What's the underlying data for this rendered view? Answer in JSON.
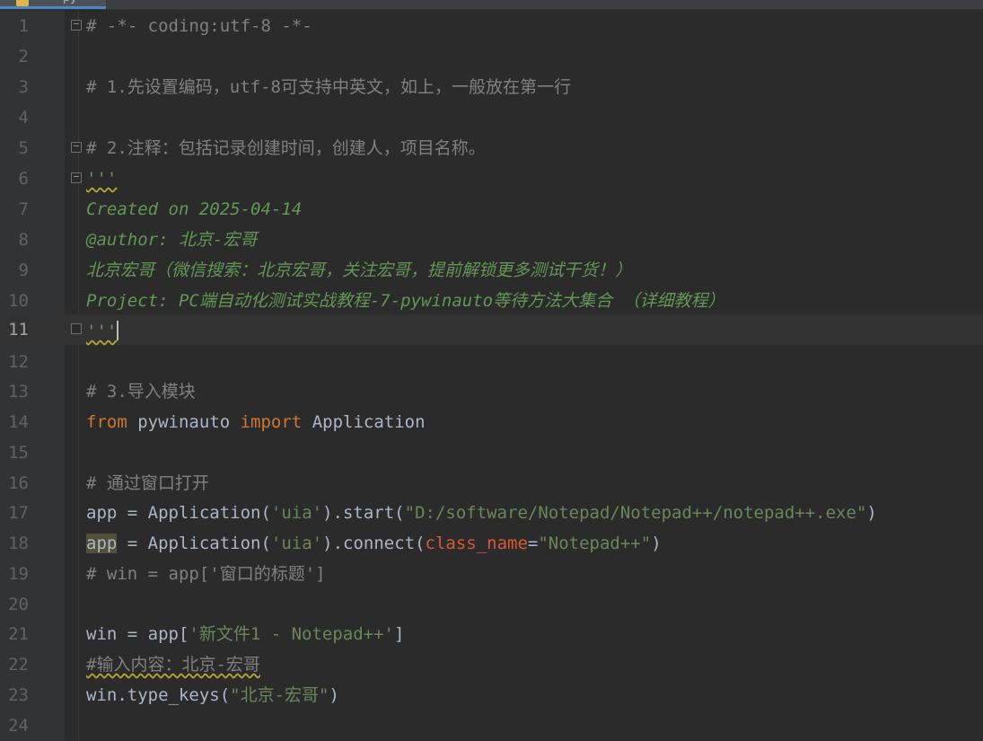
{
  "tab": {
    "label": "py"
  },
  "editor": {
    "current_line": 11,
    "lines": [
      {
        "num": "1",
        "text": "# -*- coding:utf-8 -*-"
      },
      {
        "num": "2",
        "text": ""
      },
      {
        "num": "3",
        "text": "# 1.先设置编码，utf-8可支持中英文，如上，一般放在第一行"
      },
      {
        "num": "4",
        "text": ""
      },
      {
        "num": "5",
        "text": "# 2.注释：包括记录创建时间，创建人，项目名称。"
      },
      {
        "num": "6",
        "text": "'''"
      },
      {
        "num": "7",
        "text": "Created on 2025-04-14"
      },
      {
        "num": "8",
        "text": "@author: 北京-宏哥"
      },
      {
        "num": "9",
        "text": "北京宏哥（微信搜索：北京宏哥，关注宏哥，提前解锁更多测试干货！）"
      },
      {
        "num": "10",
        "text": "Project: PC端自动化测试实战教程-7-pywinauto等待方法大集合 （详细教程）"
      },
      {
        "num": "11",
        "text": "'''"
      },
      {
        "num": "12",
        "text": ""
      },
      {
        "num": "13",
        "text": "# 3.导入模块"
      },
      {
        "num": "14",
        "kw1": "from",
        "mod": " pywinauto ",
        "kw2": "import",
        "rest": " Application"
      },
      {
        "num": "15",
        "text": ""
      },
      {
        "num": "16",
        "text": "# 通过窗口打开"
      },
      {
        "num": "17",
        "a": "app = Application(",
        "s1": "'uia'",
        "b": ").start(",
        "s2": "\"D:/software/Notepad/Notepad++/notepad++.exe\"",
        "c": ")"
      },
      {
        "num": "18",
        "var": "app",
        "a": " = Application(",
        "s1": "'uia'",
        "b": ").connect(",
        "param": "class_name",
        "eq": "=",
        "s2": "\"Notepad++\"",
        "c": ")"
      },
      {
        "num": "19",
        "text": "# win = app['窗口的标题']"
      },
      {
        "num": "20",
        "text": ""
      },
      {
        "num": "21",
        "a": "win = app[",
        "s1": "'新文件1 - Notepad++'",
        "c": "]"
      },
      {
        "num": "22",
        "text": "#输入内容：北京-宏哥"
      },
      {
        "num": "23",
        "a": "win.type_keys(",
        "s1": "\"北京-宏哥\"",
        "c": ")"
      },
      {
        "num": "24",
        "text": ""
      }
    ]
  }
}
